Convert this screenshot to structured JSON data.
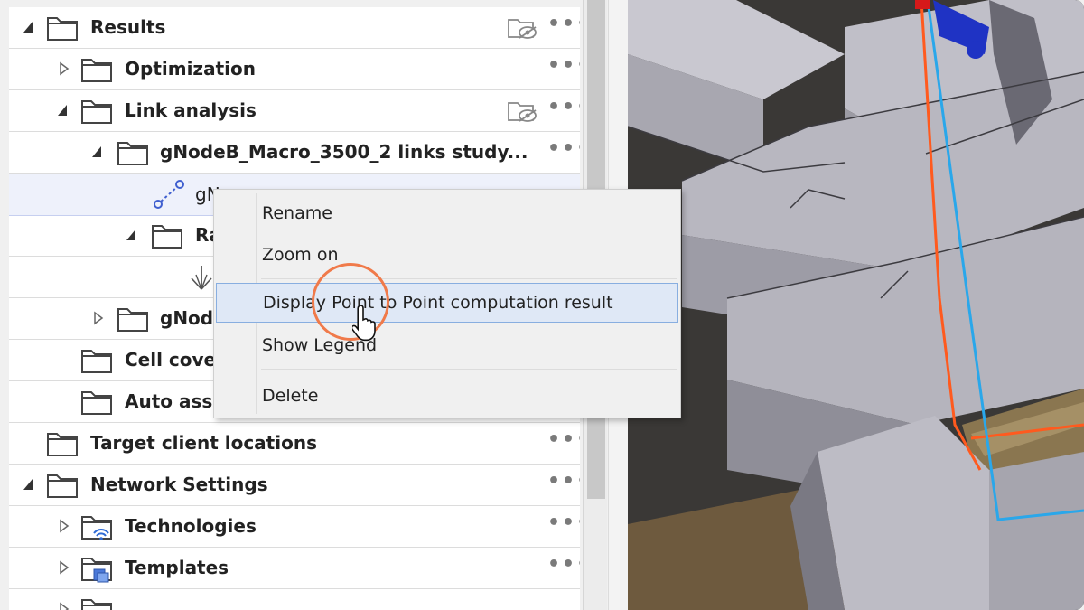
{
  "tree": {
    "rows": [
      {
        "label": "Results",
        "expanded": true
      },
      {
        "label": "Optimization",
        "expanded": false
      },
      {
        "label": "Link analysis",
        "expanded": true
      },
      {
        "label": "gNodeB_Macro_3500_2 links study...",
        "expanded": true
      },
      {
        "label": "gN",
        "selected": true
      },
      {
        "label": "Ra",
        "expanded": true
      },
      {
        "label": ""
      },
      {
        "label": "gNod",
        "expanded": false
      },
      {
        "label": "Cell cover"
      },
      {
        "label": "Auto assig"
      },
      {
        "label": "Target client locations"
      },
      {
        "label": "Network Settings",
        "expanded": true
      },
      {
        "label": "Technologies",
        "expanded": false
      },
      {
        "label": "Templates",
        "expanded": false
      },
      {
        "label": ""
      }
    ],
    "more_glyph": "•••"
  },
  "context_menu": {
    "items": [
      {
        "label": "Rename"
      },
      {
        "label": "Zoom on"
      },
      {
        "label": "Display Point to Point computation result",
        "highlighted": true
      },
      {
        "label": "Show Legend"
      },
      {
        "label": "Delete"
      }
    ]
  },
  "colors": {
    "accent_ring": "#f07a4a",
    "link_icon": "#3f5fcf",
    "highlight_bg": "#dfe8f6",
    "highlight_border": "#88aee0",
    "ray_orange": "#ff5a1e",
    "ray_blue": "#2aa7ea"
  }
}
